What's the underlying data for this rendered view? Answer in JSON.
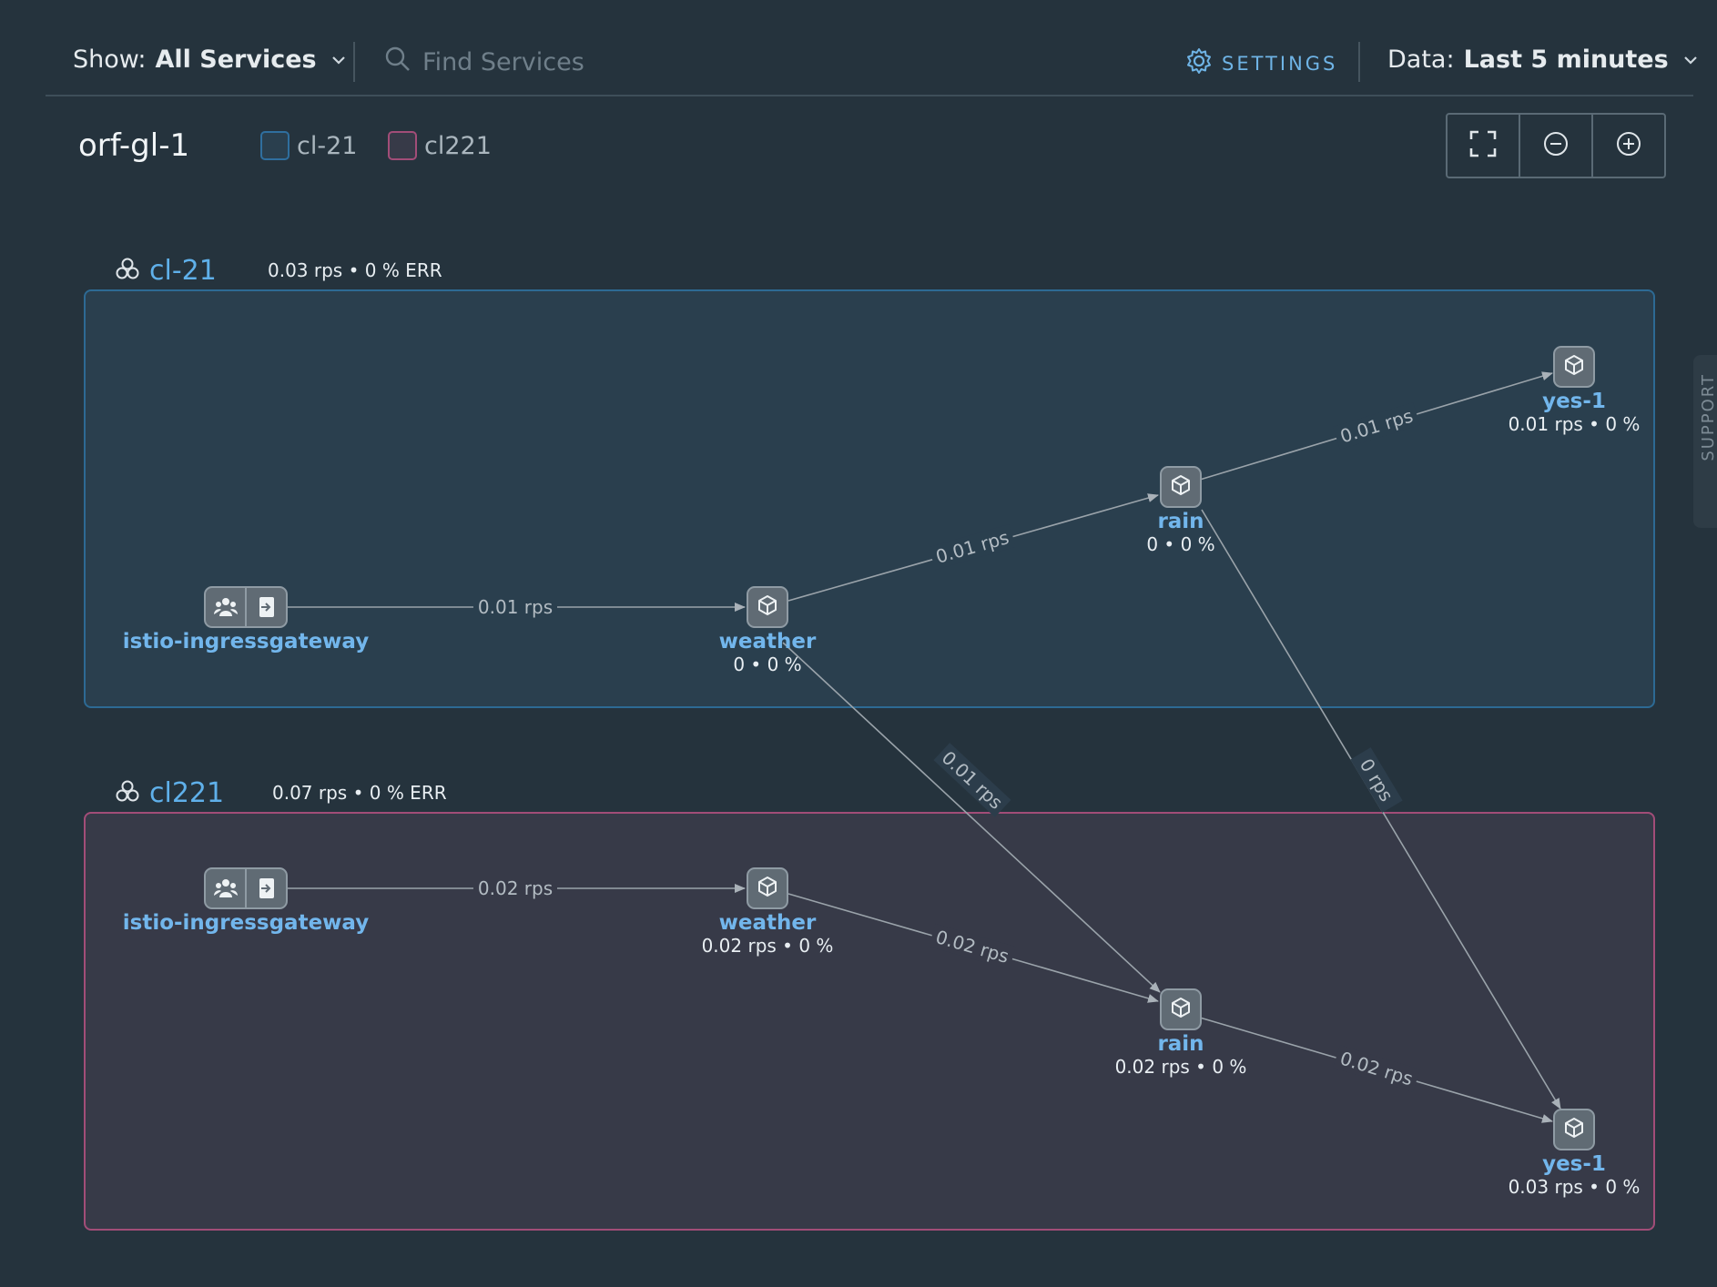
{
  "toolbar": {
    "show_label": "Show:",
    "show_value": "All Services",
    "search_placeholder": "Find Services",
    "settings_label": "SETTINGS",
    "data_label": "Data:",
    "data_value": "Last 5 minutes"
  },
  "graph": {
    "title": "orf-gl-1",
    "legend": [
      {
        "name": "cl-21",
        "color": "#2f6f9f"
      },
      {
        "name": "cl221",
        "color": "#a24d78"
      }
    ]
  },
  "clusters": {
    "a": {
      "name": "cl-21",
      "stats": "0.03 rps • 0 % ERR",
      "border": "#2d6a94",
      "fill": "#2a3f4e"
    },
    "b": {
      "name": "cl221",
      "stats": "0.07 rps • 0 % ERR",
      "border": "#a24d78",
      "fill": "#373a48"
    }
  },
  "nodes": {
    "a_gateway": {
      "label": "istio-ingressgateway"
    },
    "a_weather": {
      "label": "weather",
      "stats": "0 • 0 %"
    },
    "a_rain": {
      "label": "rain",
      "stats": "0 • 0 %"
    },
    "a_yes": {
      "label": "yes-1",
      "stats": "0.01 rps • 0 %"
    },
    "b_gateway": {
      "label": "istio-ingressgateway"
    },
    "b_weather": {
      "label": "weather",
      "stats": "0.02 rps • 0 %"
    },
    "b_rain": {
      "label": "rain",
      "stats": "0.02 rps • 0 %"
    },
    "b_yes": {
      "label": "yes-1",
      "stats": "0.03 rps • 0 %"
    }
  },
  "edges": {
    "a_gw_weather": "0.01 rps",
    "a_weather_rain": "0.01 rps",
    "a_rain_yes": "0.01 rps",
    "a_weather_b_rain": "0.01 rps",
    "a_rain_b_yes": "0 rps",
    "b_gw_weather": "0.02 rps",
    "b_weather_rain": "0.02 rps",
    "b_rain_yes": "0.02 rps"
  },
  "support_label": "SUPPORT"
}
